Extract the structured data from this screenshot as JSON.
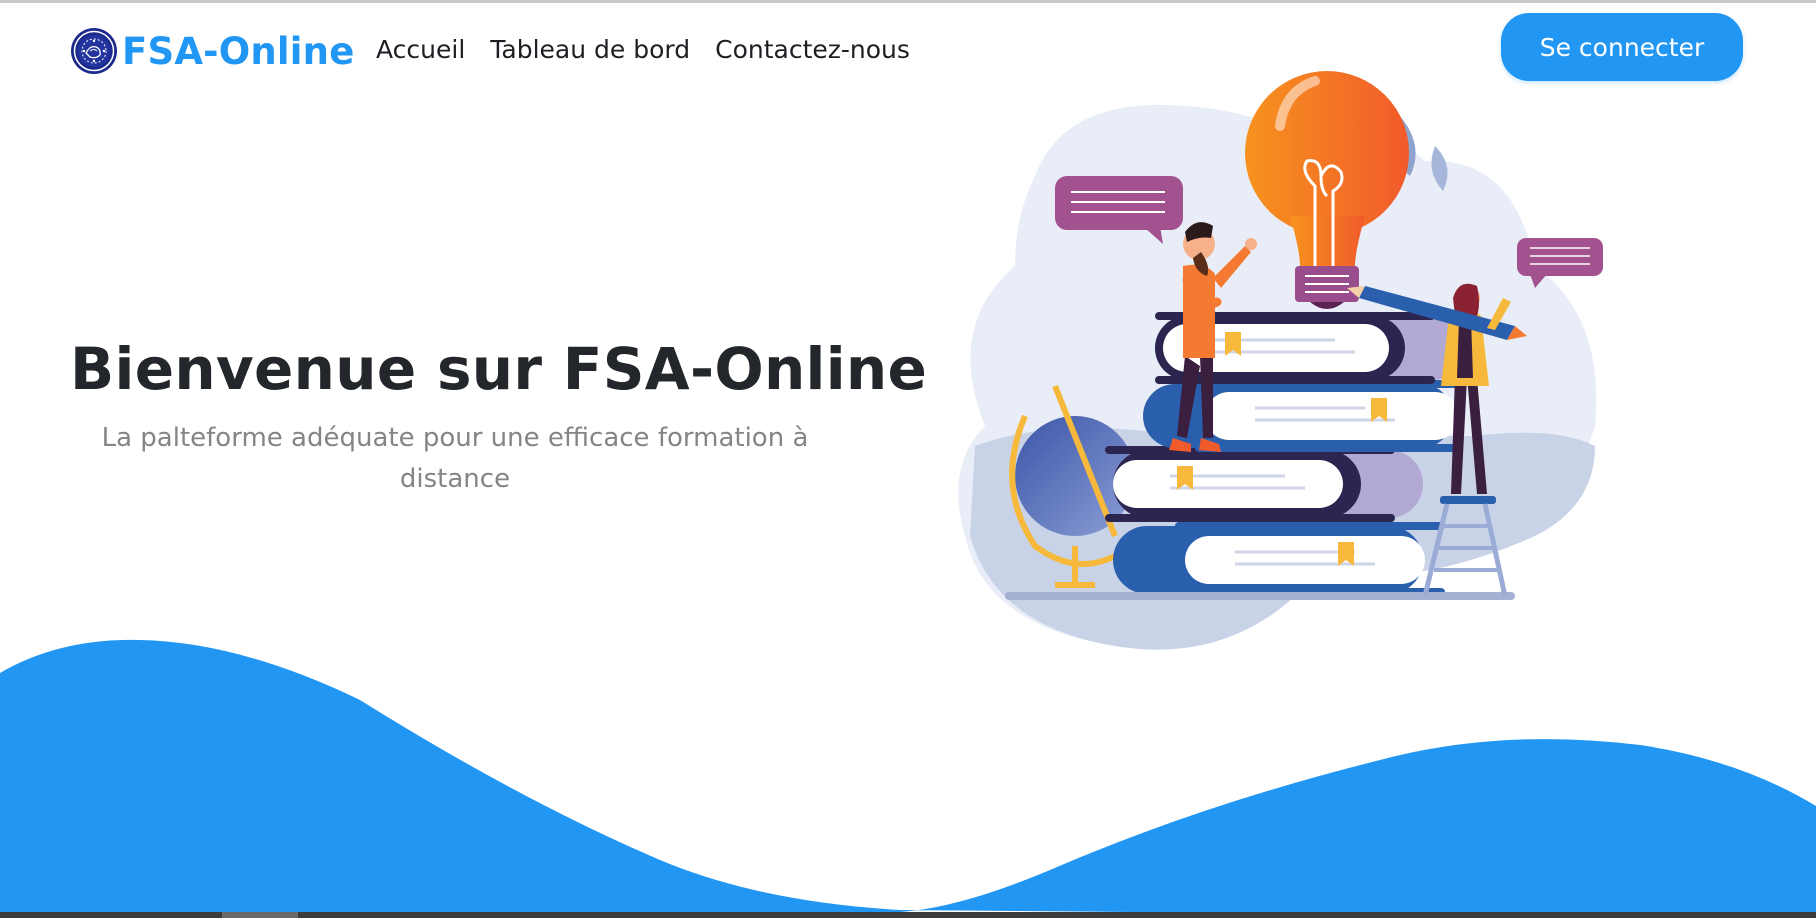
{
  "navbar": {
    "brand_text": "FSA-Online",
    "links": [
      "Accueil",
      "Tableau de bord",
      "Contactez-nous"
    ],
    "login_label": "Se connecter"
  },
  "hero": {
    "title": "Bienvenue sur FSA-Online",
    "subtitle": "La palteforme adéquate pour une efficace formation à distance"
  },
  "icons": {
    "logo": "university-seal-icon",
    "illustration": "books-lightbulb-illustration"
  },
  "colors": {
    "primary": "#2196f3",
    "title": "#23262b",
    "subtitle": "#858585",
    "nav_text": "#1d1f24"
  }
}
